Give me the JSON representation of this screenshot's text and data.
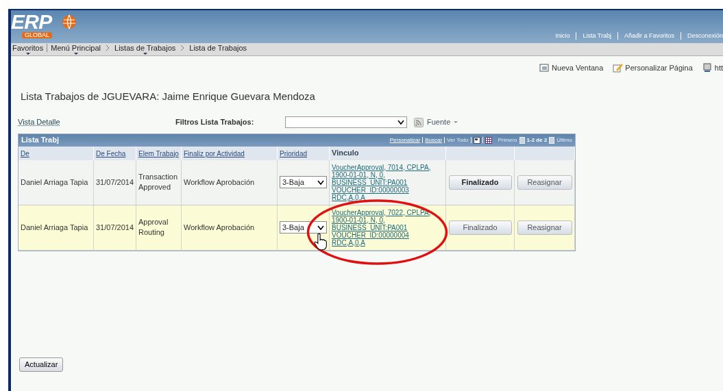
{
  "header": {
    "logo_main": "ERP",
    "logo_sub": "GLOBAL",
    "links": [
      "Inicio",
      "Lista Trabj",
      "Añadir a Favoritos",
      "Desconexión"
    ]
  },
  "breadcrumb": [
    {
      "label": "Favoritos",
      "menu": true
    },
    {
      "label": "Menú Principal",
      "menu": true
    },
    {
      "label": "Listas de Trabajos",
      "menu": true
    },
    {
      "label": "Lista de Trabajos",
      "menu": false
    }
  ],
  "page_actions": [
    "Nueva Ventana",
    "Personalizar Página",
    "htt"
  ],
  "title": "Lista Trabajos de JGUEVARA: Jaime Enrique Guevara Mendoza",
  "detail_link": "Vista Detalle",
  "filter": {
    "label": "Filtros Lista Trabajos:",
    "source": "Fuente"
  },
  "grid": {
    "title": "Lista Trabj",
    "nav": {
      "customize": "Personalizar",
      "find": "Buscar",
      "view_all": "Ver Todo",
      "first": "Primero",
      "range": "1-2 de 2",
      "last": "Último"
    },
    "columns": [
      "De",
      "De Fecha",
      "Elem Trabajo",
      "Finaliz por Actividad",
      "Prioridad",
      "Vinculo"
    ],
    "rows": [
      {
        "from": "Daniel Arriaga Tapia",
        "date": "31/07/2014",
        "item": "Transaction Approved",
        "activity": "Workflow Aprobación",
        "priority": "3-Baja",
        "link": "VoucherApproval, 7014, CPLPA, 1900-01-01, N, 0, BUSINESS_UNIT:PA001 VOUCHER_ID:00000003 RDC,A,0,A",
        "done": "Finalizado",
        "reassign": "Reasignar",
        "selected": false
      },
      {
        "from": "Daniel Arriaga Tapia",
        "date": "31/07/2014",
        "item": "Approval Routing",
        "activity": "Workflow Aprobación",
        "priority": "3-Baja",
        "link": "VoucherApproval, 7022, CPLPA, 1900-01-01, N, 0, BUSINESS_UNIT:PA001 VOUCHER_ID:00000004 RDC,A,0,A",
        "done": "Finalizado",
        "reassign": "Reasignar",
        "selected": true
      }
    ]
  },
  "refresh_button": "Actualizar"
}
